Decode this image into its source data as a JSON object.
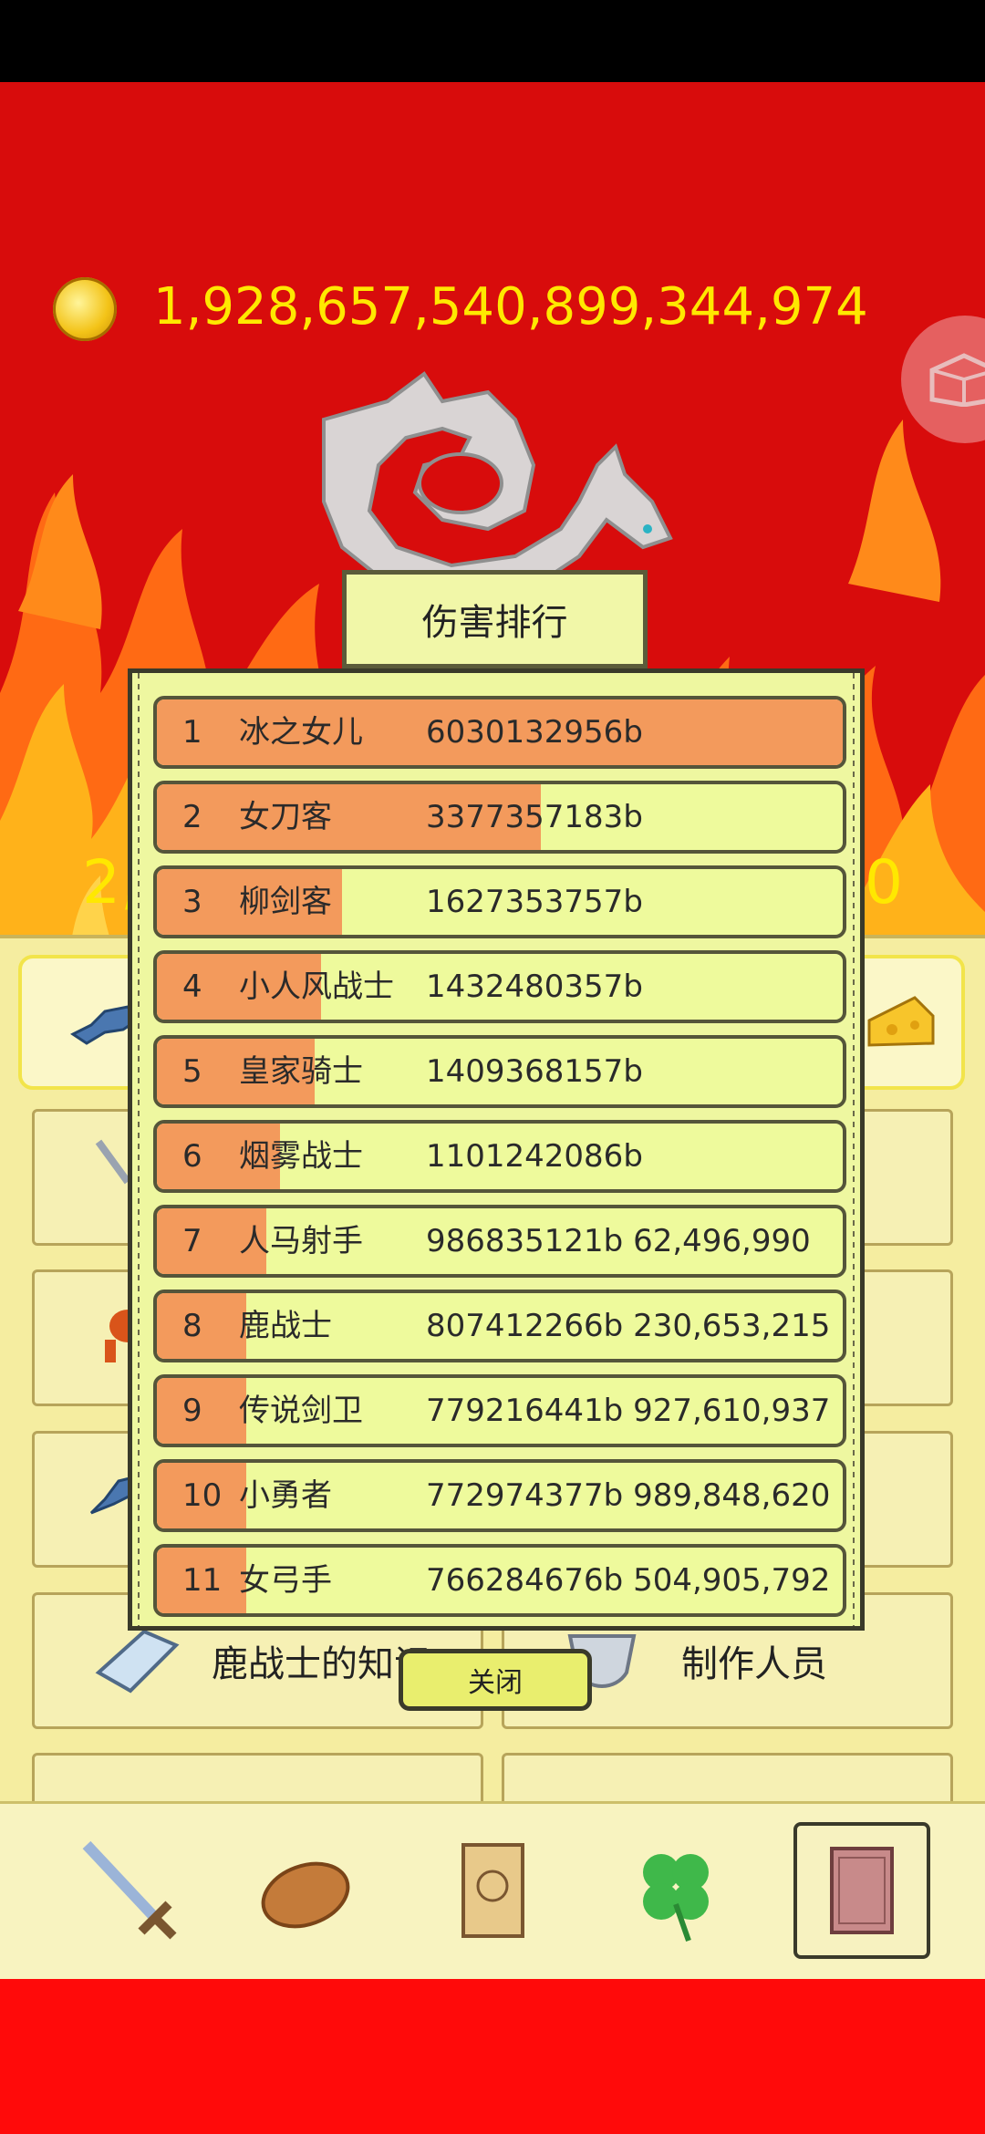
{
  "gold": {
    "amount": "1,928,657,540,899,344,974",
    "icon": "gold-coin-icon"
  },
  "background_numbers": {
    "left": "2,",
    "right": "0"
  },
  "menu_cards": {
    "knowledge": "鹿战士的知识",
    "credits": "制作人员"
  },
  "ranking": {
    "title": "伤害排行",
    "close_label": "关闭",
    "bar_color": "#f39a5c",
    "rows": [
      {
        "rank": "1",
        "name": "冰之女儿",
        "damage": "6030132956b",
        "fill": 1.0
      },
      {
        "rank": "2",
        "name": "女刀客",
        "damage": "3377357183b",
        "fill": 0.56
      },
      {
        "rank": "3",
        "name": "柳剑客",
        "damage": "1627353757b",
        "fill": 0.27
      },
      {
        "rank": "4",
        "name": "小人风战士",
        "damage": "1432480357b",
        "fill": 0.24
      },
      {
        "rank": "5",
        "name": "皇家骑士",
        "damage": "1409368157b",
        "fill": 0.23
      },
      {
        "rank": "6",
        "name": "烟雾战士",
        "damage": "1101242086b",
        "fill": 0.18
      },
      {
        "rank": "7",
        "name": "人马射手",
        "damage": "986835121b 62,496,990",
        "fill": 0.16
      },
      {
        "rank": "8",
        "name": "鹿战士",
        "damage": "807412266b 230,653,215",
        "fill": 0.13
      },
      {
        "rank": "9",
        "name": "传说剑卫",
        "damage": "779216441b 927,610,937",
        "fill": 0.13
      },
      {
        "rank": "10",
        "name": "小勇者",
        "damage": "772974377b 989,848,620",
        "fill": 0.13
      },
      {
        "rank": "11",
        "name": "女弓手",
        "damage": "766284676b 504,905,792",
        "fill": 0.13
      }
    ]
  },
  "bottom_nav": [
    {
      "icon": "sword-icon"
    },
    {
      "icon": "bread-icon"
    },
    {
      "icon": "scroll-icon"
    },
    {
      "icon": "clover-icon"
    },
    {
      "icon": "book-icon",
      "selected": true
    }
  ]
}
